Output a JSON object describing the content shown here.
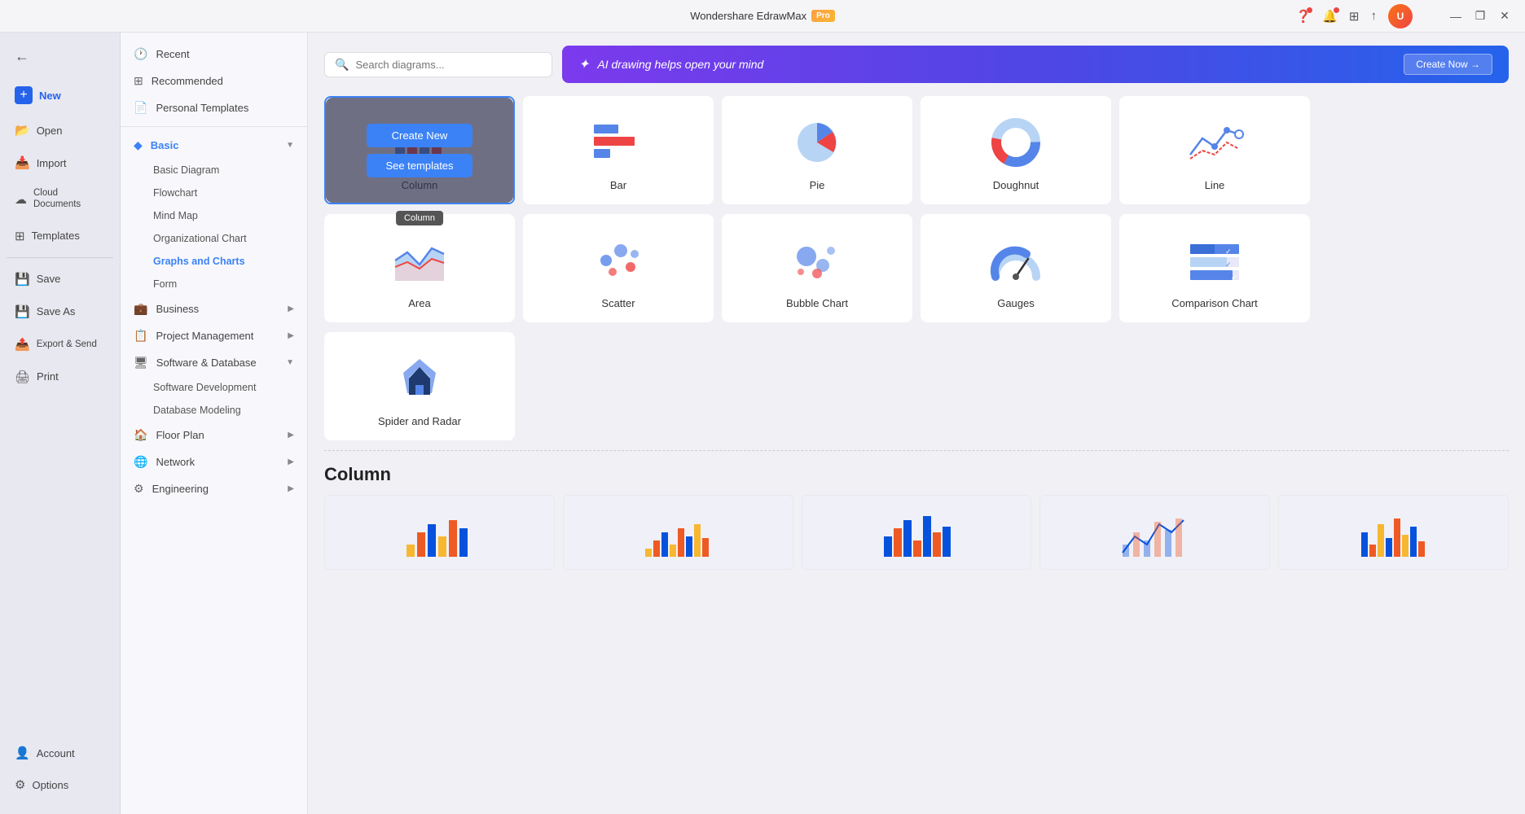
{
  "app": {
    "title": "Wondershare EdrawMax",
    "pro_label": "Pro"
  },
  "titlebar": {
    "minimize": "—",
    "maximize": "❐",
    "close": "✕"
  },
  "left_sidebar": {
    "new_label": "New",
    "items": [
      {
        "id": "open",
        "label": "Open",
        "icon": "📂"
      },
      {
        "id": "import",
        "label": "Import",
        "icon": "📥"
      },
      {
        "id": "cloud",
        "label": "Cloud Documents",
        "icon": "☁"
      },
      {
        "id": "templates",
        "label": "Templates",
        "icon": "⊞"
      },
      {
        "id": "save",
        "label": "Save",
        "icon": "💾"
      },
      {
        "id": "save-as",
        "label": "Save As",
        "icon": "💾"
      },
      {
        "id": "export",
        "label": "Export & Send",
        "icon": "📤"
      },
      {
        "id": "print",
        "label": "Print",
        "icon": "🖨"
      }
    ],
    "bottom": [
      {
        "id": "account",
        "label": "Account",
        "icon": "👤"
      },
      {
        "id": "options",
        "label": "Options",
        "icon": "⚙"
      }
    ]
  },
  "nav": {
    "top_items": [
      {
        "id": "recent",
        "label": "Recent",
        "icon": "🕐"
      },
      {
        "id": "recommended",
        "label": "Recommended",
        "icon": "⊞"
      },
      {
        "id": "personal",
        "label": "Personal Templates",
        "icon": "📄"
      }
    ],
    "categories": [
      {
        "id": "basic",
        "label": "Basic",
        "icon": "◆",
        "expanded": true,
        "sub_items": [
          {
            "id": "basic-diagram",
            "label": "Basic Diagram"
          },
          {
            "id": "flowchart",
            "label": "Flowchart"
          },
          {
            "id": "mind-map",
            "label": "Mind Map"
          },
          {
            "id": "org-chart",
            "label": "Organizational Chart"
          },
          {
            "id": "graphs-charts",
            "label": "Graphs and Charts",
            "active": true
          },
          {
            "id": "form",
            "label": "Form"
          }
        ]
      },
      {
        "id": "business",
        "label": "Business",
        "icon": "💼",
        "has_arrow": true
      },
      {
        "id": "project",
        "label": "Project Management",
        "icon": "📋",
        "has_arrow": true
      },
      {
        "id": "software",
        "label": "Software & Database",
        "icon": "🖥",
        "expanded": true,
        "sub_items": [
          {
            "id": "software-dev",
            "label": "Software Development"
          },
          {
            "id": "db-modeling",
            "label": "Database Modeling"
          }
        ]
      },
      {
        "id": "floor-plan",
        "label": "Floor Plan",
        "icon": "🏠",
        "has_arrow": true
      },
      {
        "id": "network",
        "label": "Network",
        "icon": "🌐",
        "has_arrow": true
      },
      {
        "id": "engineering",
        "label": "Engineering",
        "icon": "⚙",
        "has_arrow": true
      }
    ]
  },
  "topbar": {
    "search_placeholder": "Search diagrams...",
    "ai_text": "AI drawing helps open your mind",
    "create_now": "Create Now →"
  },
  "chart_types": [
    {
      "id": "column",
      "label": "Column",
      "selected": true,
      "tooltip": "Column"
    },
    {
      "id": "bar",
      "label": "Bar"
    },
    {
      "id": "pie",
      "label": "Pie"
    },
    {
      "id": "doughnut",
      "label": "Doughnut"
    },
    {
      "id": "line",
      "label": "Line"
    },
    {
      "id": "area",
      "label": "Area"
    },
    {
      "id": "scatter",
      "label": "Scatter"
    },
    {
      "id": "bubble",
      "label": "Bubble Chart"
    },
    {
      "id": "gauges",
      "label": "Gauges"
    },
    {
      "id": "comparison",
      "label": "Comparison Chart"
    },
    {
      "id": "spider",
      "label": "Spider and Radar"
    }
  ],
  "overlay": {
    "create_new": "Create New",
    "see_templates": "See templates"
  },
  "section": {
    "title": "Column"
  },
  "colors": {
    "accent": "#3b82f6",
    "pro_bg": "#f7b731",
    "active_nav": "#3b82f6"
  }
}
